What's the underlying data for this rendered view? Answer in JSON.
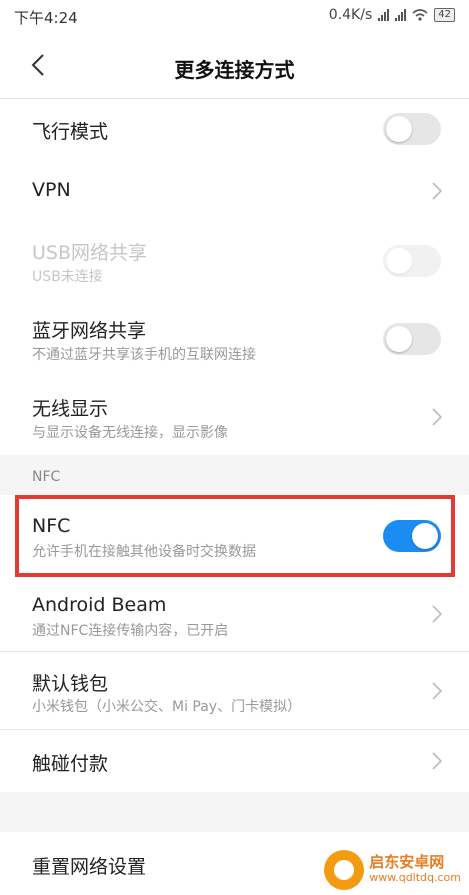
{
  "status": {
    "time": "下午4:24",
    "speed": "0.4K/s",
    "battery": "42"
  },
  "header": {
    "title": "更多连接方式",
    "back_icon": "chevron-left-icon"
  },
  "rows": {
    "airplane": {
      "label": "飞行模式",
      "switch_on": false
    },
    "vpn": {
      "label": "VPN"
    },
    "usb": {
      "label": "USB网络共享",
      "sub": "USB未连接",
      "disabled": true
    },
    "bt": {
      "label": "蓝牙网络共享",
      "sub": "不通过蓝牙共享该手机的互联网连接",
      "switch_on": false
    },
    "display": {
      "label": "无线显示",
      "sub": "与显示设备无线连接，显示影像"
    },
    "nfc": {
      "label": "NFC",
      "sub": "允许手机在接触其他设备时交换数据",
      "switch_on": true
    },
    "beam": {
      "label": "Android Beam",
      "sub": "通过NFC连接传输内容，已开启"
    },
    "wallet": {
      "label": "默认钱包",
      "sub": "小米钱包（小米公交、Mi Pay、门卡模拟）"
    },
    "pay": {
      "label": "触碰付款"
    },
    "reset": {
      "label": "重置网络设置"
    }
  },
  "sections": {
    "nfc_title": "NFC"
  },
  "colors": {
    "accent": "#1b8df2",
    "highlight": "#e53935",
    "watermark": "#e67e22"
  },
  "watermark": {
    "name": "启东安卓网",
    "url": "www.qdltdq.com"
  }
}
